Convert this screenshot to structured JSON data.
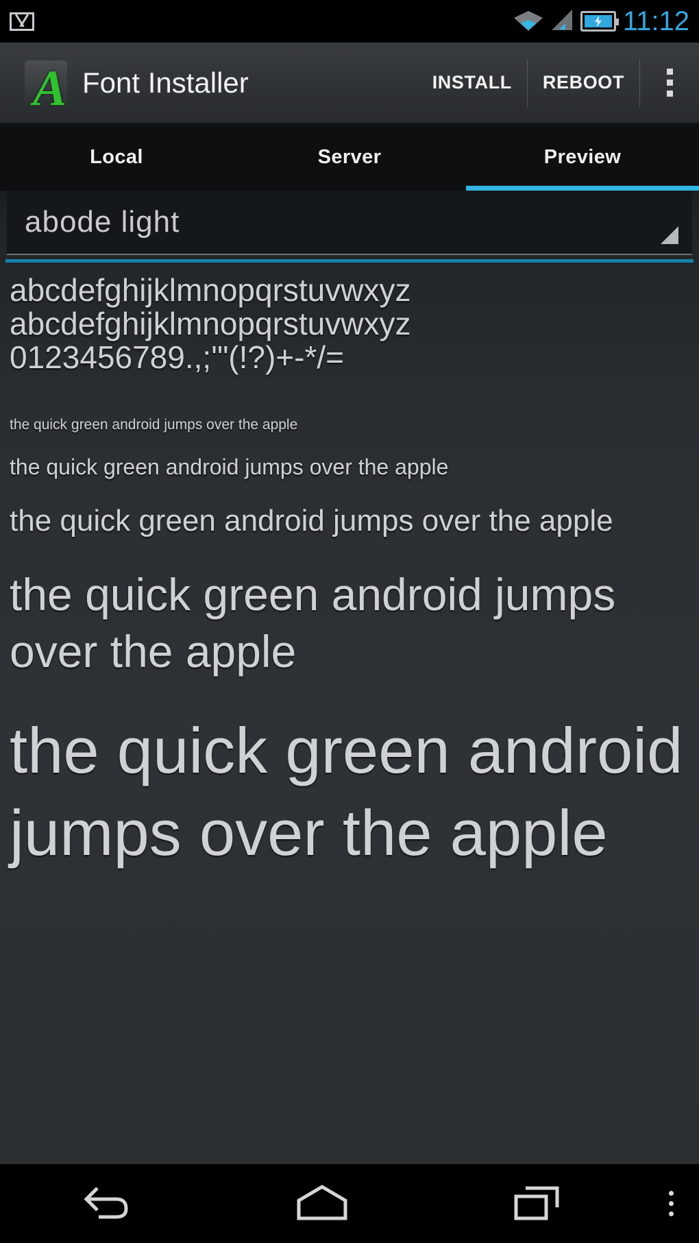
{
  "status_bar": {
    "notification_icon": "gmail-icon",
    "wifi_icon": "wifi-icon",
    "signal_icon": "cell-signal-icon",
    "battery_icon": "battery-charging-icon",
    "time": "11:12",
    "accent_color": "#33b5e5"
  },
  "action_bar": {
    "app_icon": "font-installer-icon",
    "app_icon_letter": "A",
    "title": "Font Installer",
    "install_label": "INSTALL",
    "reboot_label": "REBOOT",
    "overflow_label": "More options"
  },
  "tabs": {
    "items": [
      {
        "label": "Local",
        "active": false
      },
      {
        "label": "Server",
        "active": false
      },
      {
        "label": "Preview",
        "active": true
      }
    ],
    "indicator_color": "#33b5e5"
  },
  "preview": {
    "font_selector": {
      "selected": "abode light",
      "arrow_icon": "dropdown-triangle-icon"
    },
    "glyph_lines": [
      "abcdefghijklmnopqrstuvwxyz",
      "abcdefghijklmnopqrstuvwxyz",
      "0123456789.,;'\"(!?)+-*/="
    ],
    "pangram": "the quick green android jumps over the apple",
    "sizes": [
      "xs",
      "sm",
      "md",
      "lg",
      "xl"
    ]
  },
  "nav_bar": {
    "back_label": "Back",
    "home_label": "Home",
    "recents_label": "Recent apps",
    "menu_label": "Menu"
  }
}
